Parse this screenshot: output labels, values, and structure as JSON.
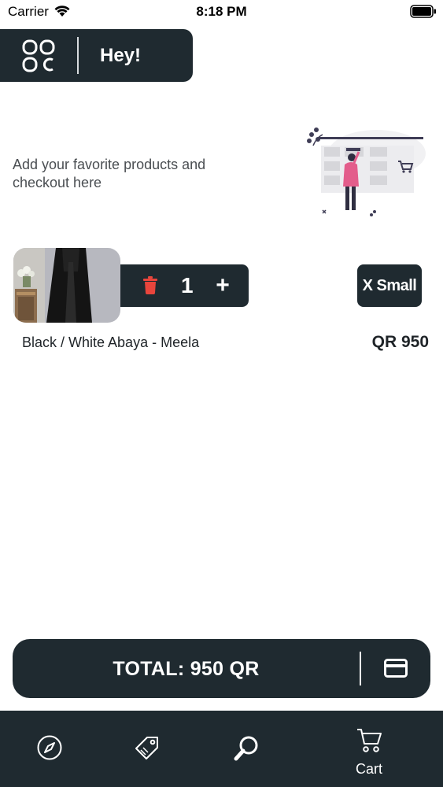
{
  "status_bar": {
    "carrier": "Carrier",
    "time": "8:18 PM"
  },
  "header": {
    "title": "Hey!",
    "menu_icon": "grid-menu-icon"
  },
  "intro": {
    "text": "Add your favorite products and checkout here",
    "illustration": "shopping-woman-illustration"
  },
  "cart": {
    "items": [
      {
        "name": "Black / White Abaya - Meela",
        "price": "QR 950",
        "quantity": "1",
        "size": "X Small",
        "plus_label": "+"
      }
    ]
  },
  "checkout": {
    "total_label": "TOTAL: 950 QR",
    "icon": "credit-card-icon"
  },
  "tab_bar": {
    "tabs": [
      {
        "icon": "compass-icon",
        "label": ""
      },
      {
        "icon": "tag-icon",
        "label": ""
      },
      {
        "icon": "search-icon",
        "label": ""
      },
      {
        "icon": "cart-icon",
        "label": "Cart"
      }
    ]
  },
  "colors": {
    "dark": "#1f2a30",
    "accent_red": "#e8453c",
    "text": "#1f2428"
  }
}
